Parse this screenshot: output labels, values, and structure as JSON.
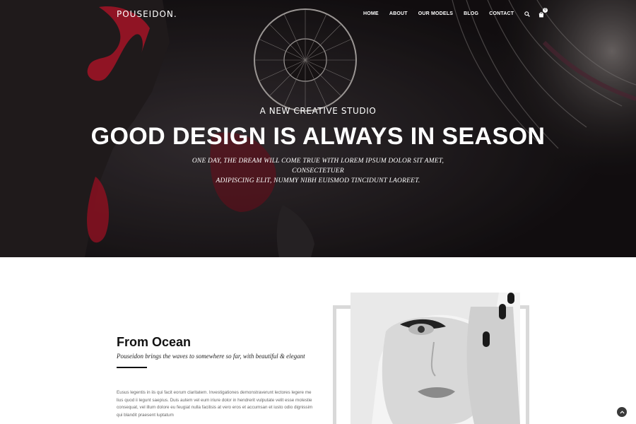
{
  "brand": {
    "logo": "POUSEIDON."
  },
  "nav": {
    "items": [
      {
        "label": "HOME"
      },
      {
        "label": "ABOUT"
      },
      {
        "label": "OUR MODELS"
      },
      {
        "label": "BLOG"
      },
      {
        "label": "CONTACT"
      }
    ],
    "search_icon": "search-icon",
    "cart_icon": "shopping-bag-icon",
    "cart_count": "0"
  },
  "hero": {
    "subtitle": "A NEW CREATIVE STUDIO",
    "title": "GOOD DESIGN IS ALWAYS IN SEASON",
    "text_line1": "ONE DAY, THE DREAM WILL COME TRUE WITH LOREM IPSUM DOLOR SIT AMET, CONSECTETUER",
    "text_line2": "ADIPISCING ELIT, NUMMY NIBH EUISMOD TINCIDUNT LAOREET."
  },
  "about": {
    "heading": "From Ocean",
    "tagline": "Pouseidon brings the waves to somewhere so far, with beautiful & elegant",
    "body_lines": [
      "Eusus legentis in iis qui facit eorum claritatem. Investigationes demonstraverunt lectores legere me",
      "lius quod ii legunt saepius. Duis autem vel eum iriure dolor in hendrerit vulputate velit esse molestie",
      "consequat, vel illum dolore eu feugiat nulla facilisis at vero eros et accumsan et iusto odio dignissim",
      "qui blandit praesent luptatum"
    ]
  },
  "colors": {
    "hero_accent_red": "#c0182e",
    "text_dark": "#111111",
    "text_muted": "#666666",
    "frame_gray": "#d9d9d9"
  },
  "scroll_top_icon": "chevron-up-icon"
}
